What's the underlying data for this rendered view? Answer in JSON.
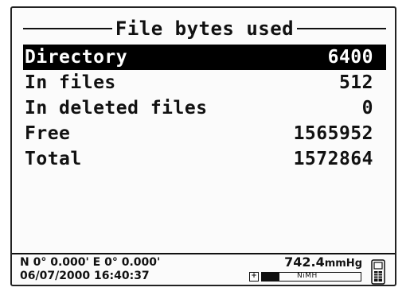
{
  "title": "File bytes used",
  "rows": [
    {
      "label": "Directory",
      "value": "6400"
    },
    {
      "label": "In files",
      "value": "512"
    },
    {
      "label": "In deleted files",
      "value": "0"
    },
    {
      "label": "Free",
      "value": "1565952"
    },
    {
      "label": "Total",
      "value": "1572864"
    }
  ],
  "selected_row": "Directory",
  "status_bar": {
    "gps": "N 0° 0.000' E 0° 0.000'",
    "datetime": "06/07/2000 16:40:37",
    "pressure_value": "742.4",
    "pressure_unit": "mmHg",
    "battery_label": "NiMH",
    "battery_icon": "plug-icon",
    "device_icon": "handheld-device-icon"
  }
}
